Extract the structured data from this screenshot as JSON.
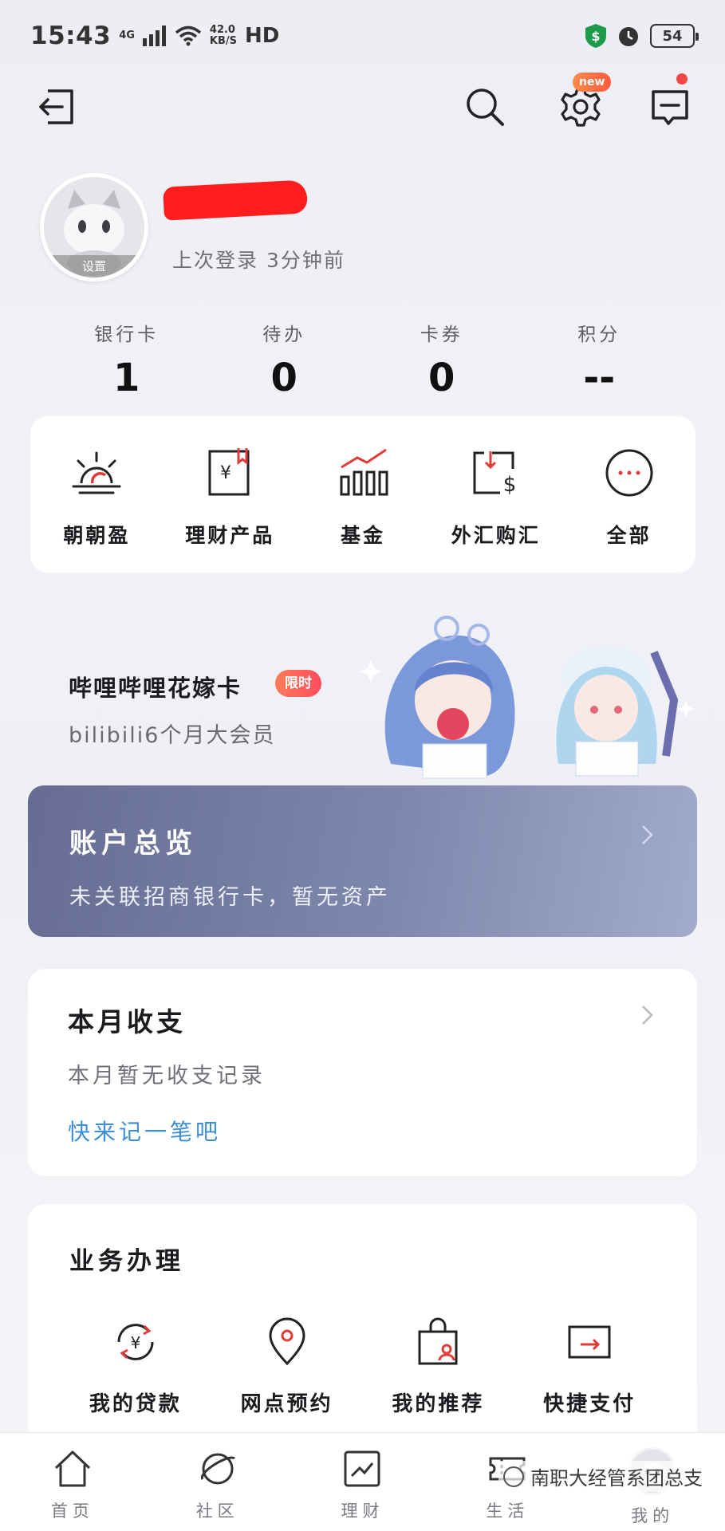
{
  "status_bar": {
    "time": "15:43",
    "network": "4G",
    "speed_top": "42.0",
    "speed_bottom": "KB/S",
    "hd": "HD",
    "battery": "54"
  },
  "top_nav": {
    "settings_badge": "new"
  },
  "profile": {
    "avatar_tag": "设置",
    "last_login": "上次登录 3分钟前"
  },
  "stats": [
    {
      "label": "银行卡",
      "value": "1"
    },
    {
      "label": "待办",
      "value": "0"
    },
    {
      "label": "卡券",
      "value": "0"
    },
    {
      "label": "积分",
      "value": "--"
    }
  ],
  "shortcuts": [
    {
      "label": "朝朝盈",
      "icon": "sunrise-icon"
    },
    {
      "label": "理财产品",
      "icon": "wealth-product-icon"
    },
    {
      "label": "基金",
      "icon": "fund-chart-icon"
    },
    {
      "label": "外汇购汇",
      "icon": "forex-icon"
    },
    {
      "label": "全部",
      "icon": "more-icon"
    }
  ],
  "banner": {
    "title": "哔哩哔哩花嫁卡",
    "tag": "限时",
    "subtitle": "bilibili6个月大会员"
  },
  "overview": {
    "title": "账户总览",
    "subtitle": "未关联招商银行卡，暂无资产"
  },
  "monthly": {
    "title": "本月收支",
    "subtitle": "本月暂无收支记录",
    "link": "快来记一笔吧"
  },
  "services": {
    "title": "业务办理",
    "items": [
      {
        "label": "我的贷款",
        "icon": "loan-icon"
      },
      {
        "label": "网点预约",
        "icon": "location-pin-icon"
      },
      {
        "label": "我的推荐",
        "icon": "shopping-bag-icon"
      },
      {
        "label": "快捷支付",
        "icon": "quick-pay-icon"
      }
    ]
  },
  "tabbar": [
    {
      "label": "首页",
      "icon": "home-icon"
    },
    {
      "label": "社区",
      "icon": "planet-icon"
    },
    {
      "label": "理财",
      "icon": "trend-icon"
    },
    {
      "label": "生活",
      "icon": "ticket-icon"
    },
    {
      "label": "我的",
      "icon": "avatar-icon"
    }
  ],
  "watermark": "南职大经管系团总支",
  "colors": {
    "accent_blue": "#3d8ed8",
    "overview_bg": "#7f87ad",
    "badge_red": "#ff5a3c",
    "redaction": "#ff1d1d"
  }
}
